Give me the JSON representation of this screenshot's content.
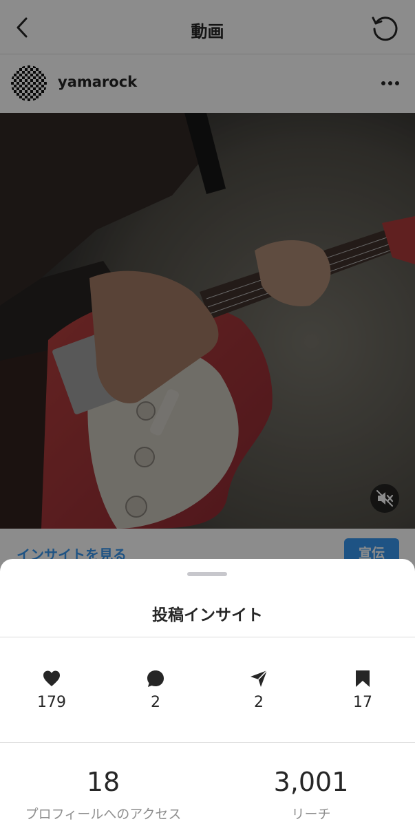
{
  "nav": {
    "title": "動画"
  },
  "post": {
    "username": "yamarock",
    "insight_link": "インサイトを見る",
    "promote_label": "宣伝"
  },
  "sheet": {
    "title": "投稿インサイト",
    "stats": {
      "likes": "179",
      "comments": "2",
      "shares": "2",
      "saves": "17"
    },
    "metrics": {
      "profile_visits_value": "18",
      "profile_visits_label": "プロフィールへのアクセス",
      "reach_value": "3,001",
      "reach_label": "リーチ"
    }
  },
  "icons": {
    "back": "chevron-left-icon",
    "refresh": "refresh-icon",
    "more": "more-horizontal-icon",
    "mute": "speaker-muted-icon",
    "like": "heart-icon",
    "comment": "comment-bubble-icon",
    "share": "paper-plane-icon",
    "save": "bookmark-icon"
  },
  "colors": {
    "accent": "#3897f0",
    "text": "#262626",
    "secondary_text": "#8e8e8e"
  }
}
